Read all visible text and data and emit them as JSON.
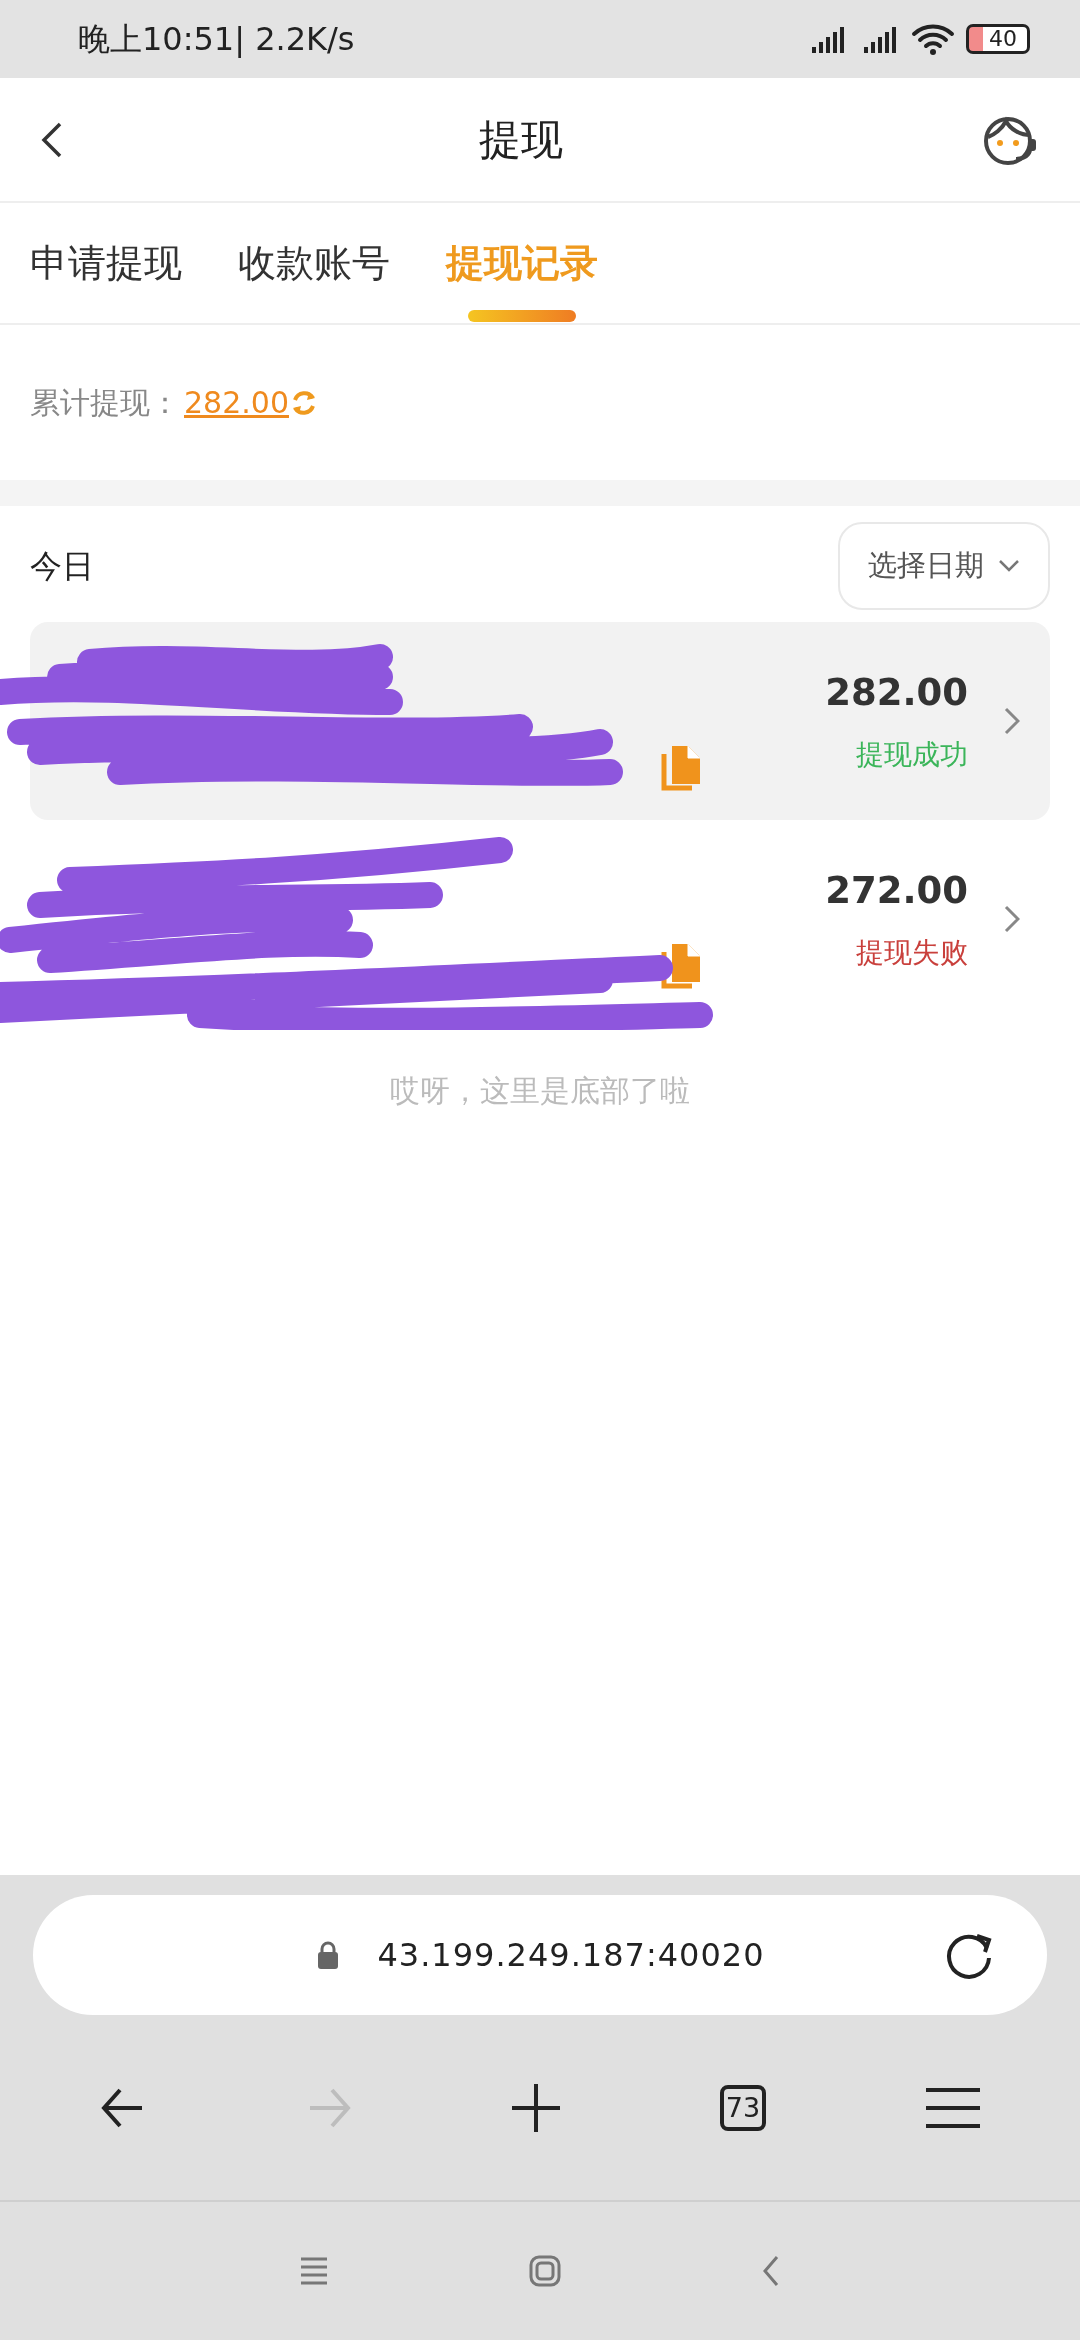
{
  "status_bar": {
    "time": "晚上10:51| 2.2K/s",
    "battery": "40"
  },
  "header": {
    "title": "提现"
  },
  "tabs": [
    {
      "label": "申请提现",
      "selected": false
    },
    {
      "label": "收款账号",
      "selected": false
    },
    {
      "label": "提现记录",
      "selected": true
    }
  ],
  "summary": {
    "label": "累计提现：",
    "amount": "282.00"
  },
  "section": {
    "title": "今日",
    "date_filter": "选择日期"
  },
  "records": [
    {
      "amount": "282.00",
      "status": "提现成功",
      "kind": "success",
      "highlighted": true
    },
    {
      "amount": "272.00",
      "status": "提现失败",
      "kind": "failed",
      "highlighted": false
    }
  ],
  "footer_text": "哎呀，这里是底部了啦",
  "browser": {
    "url": "43.199.249.187:40020",
    "tab_count": "73",
    "forward_disabled": true
  }
}
